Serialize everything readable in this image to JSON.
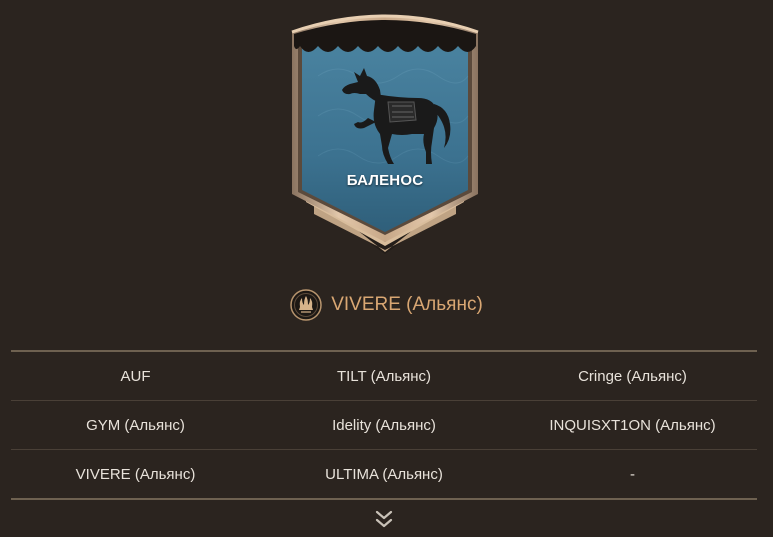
{
  "banner": {
    "name": "БАЛЕНОС",
    "emblem_icon": "horse-icon",
    "colors": {
      "cloth": "#3f7590",
      "frame": "#c9a98a",
      "frame_dark": "#7a6552"
    }
  },
  "owner": {
    "icon": "alliance-crest-icon",
    "name": "VIVERE (Альянс)",
    "color": "#d9a773"
  },
  "guilds": [
    [
      "AUF",
      "TILT (Альянс)",
      "Cringe (Альянс)"
    ],
    [
      "GYM (Альянс)",
      "Idelity (Альянс)",
      "INQUISXT1ON (Альянс)"
    ],
    [
      "VIVERE (Альянс)",
      "ULTIMA (Альянс)",
      "-"
    ]
  ],
  "expand_icon": "double-chevron-down-icon"
}
